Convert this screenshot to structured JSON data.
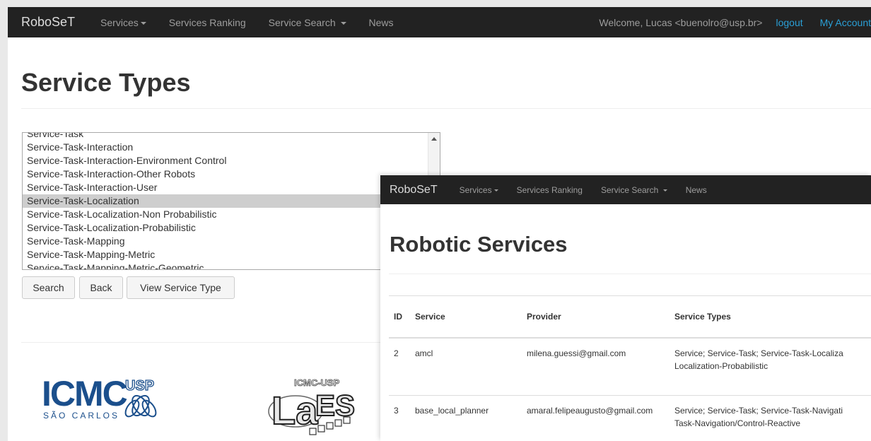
{
  "window1": {
    "navbar": {
      "brand": "RoboSeT",
      "items": [
        "Services",
        "Services Ranking",
        "Service Search",
        "News"
      ],
      "welcome": "Welcome, Lucas <buenolro@usp.br>",
      "logout": "logout",
      "account": "My Account"
    },
    "title": "Service Types",
    "list": {
      "options": [
        "Service-Task",
        "Service-Task-Interaction",
        "Service-Task-Interaction-Environment Control",
        "Service-Task-Interaction-Other Robots",
        "Service-Task-Interaction-User",
        "Service-Task-Localization",
        "Service-Task-Localization-Non Probabilistic",
        "Service-Task-Localization-Probabilistic",
        "Service-Task-Mapping",
        "Service-Task-Mapping-Metric",
        "Service-Task-Mapping-Metric-Geometric"
      ],
      "selected": "Service-Task-Localization"
    },
    "buttons": {
      "search": "Search",
      "back": "Back",
      "view": "View Service Type"
    },
    "logos": {
      "icmc_text": "ICMC",
      "usp_text": "USP",
      "city_text": "SÃO CARLOS",
      "labes_top": "ICMC-USP",
      "labes_text": "LabES"
    }
  },
  "window2": {
    "navbar": {
      "brand": "RoboSeT",
      "items": [
        "Services",
        "Services Ranking",
        "Service Search",
        "News"
      ]
    },
    "title": "Robotic Services",
    "table": {
      "headers": [
        "ID",
        "Service",
        "Provider",
        "Service Types"
      ],
      "rows": [
        {
          "id": "2",
          "service": "amcl",
          "provider": "milena.guessi@gmail.com",
          "types_line1": "Service; Service-Task; Service-Task-Localiza",
          "types_line2": "Localization-Probabilistic"
        },
        {
          "id": "3",
          "service": "base_local_planner",
          "provider": "amaral.felipeaugusto@gmail.com",
          "types_line1": "Service; Service-Task; Service-Task-Navigati",
          "types_line2": "Task-Navigation/Control-Reactive"
        }
      ]
    }
  }
}
